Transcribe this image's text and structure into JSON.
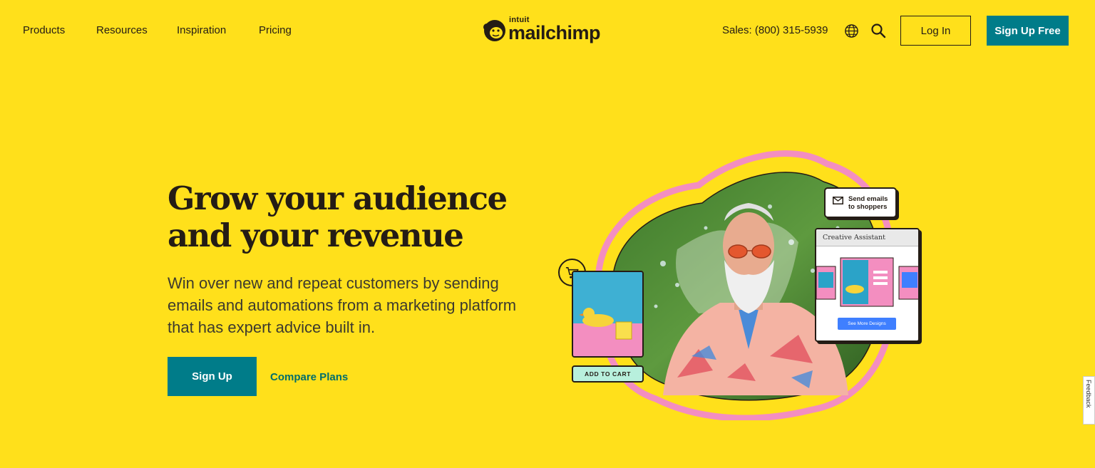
{
  "nav": {
    "items": [
      {
        "label": "Products"
      },
      {
        "label": "Resources"
      },
      {
        "label": "Inspiration"
      },
      {
        "label": "Pricing"
      }
    ]
  },
  "logo": {
    "intuit": "intuit",
    "wordmark": "mailchimp"
  },
  "header": {
    "sales": "Sales: (800) 315-5939",
    "login_label": "Log In",
    "signup_free_label": "Sign Up Free"
  },
  "hero": {
    "title_line1": "Grow your audience",
    "title_line2": "and your revenue",
    "subtitle": "Win over new and repeat customers by sending emails and automations from a marketing platform that has expert advice built in.",
    "signup_label": "Sign Up",
    "compare_label": "Compare Plans"
  },
  "illustration": {
    "send_emails": "Send emails to shoppers",
    "creative_assistant": "Creative Assistant",
    "see_more": "See More Designs",
    "add_to_cart": "ADD TO CART"
  },
  "feedback_label": "Feedback",
  "colors": {
    "background": "#ffe01b",
    "teal": "#007c89",
    "dark": "#241c15",
    "pink": "#f38ec0"
  }
}
